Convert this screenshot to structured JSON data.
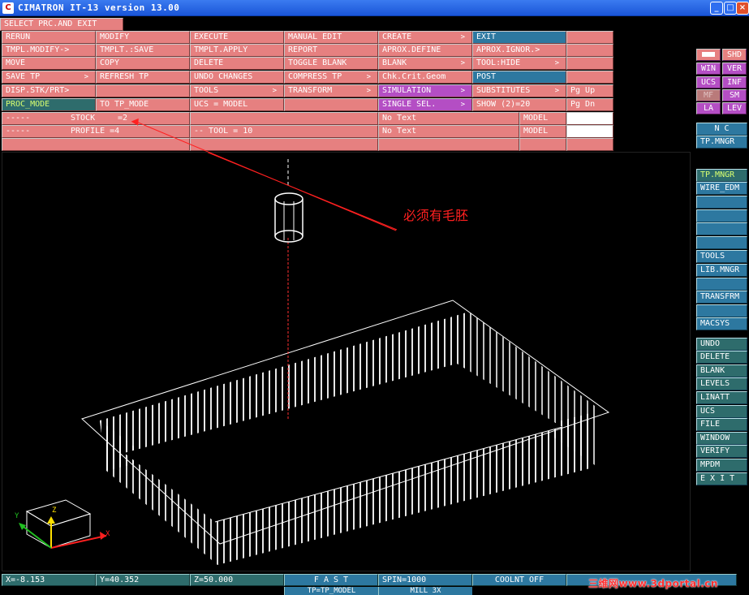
{
  "window": {
    "title": "CIMATRON IT-13 version 13.00",
    "minimize": "_",
    "maximize": "□",
    "close": "×"
  },
  "menu_title": "SELECT PRC.AND EXIT",
  "menu": {
    "rows": [
      [
        "RERUN",
        "MODIFY",
        "EXECUTE",
        "MANUAL EDIT",
        "CREATE",
        "EXIT",
        ""
      ],
      [
        "TMPL.MODIFY->",
        "TMPLT.:SAVE",
        "TMPLT.APPLY",
        "REPORT",
        "APROX.DEFINE",
        "APROX.IGNOR.>",
        ""
      ],
      [
        "MOVE",
        "COPY",
        "DELETE",
        "TOGGLE BLANK",
        "BLANK",
        "TOOL:HIDE",
        ""
      ],
      [
        "SAVE TP",
        "REFRESH TP",
        "UNDO CHANGES",
        "COMPRESS TP",
        "Chk.Crit.Geom",
        "POST",
        ""
      ],
      [
        "DISP.STK/PRT>",
        "",
        "TOOLS",
        "TRANSFORM",
        "SIMULATION",
        "SUBSTITUTES",
        "Pg Up"
      ],
      [
        "PROC_MODE",
        "TO TP_MODE",
        "UCS = MODEL",
        "",
        "SINGLE SEL.",
        "SHOW (2)=20",
        "Pg Dn"
      ]
    ],
    "arrow": ">",
    "info_rows": {
      "r1_left_a": "-----",
      "r1_left_b": "STOCK",
      "r1_left_c": "=2",
      "r1_mid": "No Text",
      "r1_model": "MODEL",
      "r2_left_a": "-----",
      "r2_left_b": "PROFILE =4",
      "r2_tool": "-- TOOL = 10",
      "r2_mid": "No Text",
      "r2_model": "MODEL"
    }
  },
  "right_small": [
    [
      "",
      "SHD"
    ],
    [
      "WIN",
      "VER"
    ],
    [
      "UCS",
      "INF"
    ],
    [
      "MF",
      "SM"
    ],
    [
      "LA",
      "LEV"
    ]
  ],
  "right_panel": {
    "nc": "N C",
    "tp_mngr_top": "TP.MNGR",
    "group1": [
      "TP.MNGR",
      "WIRE_EDM",
      "",
      "",
      "",
      "",
      "TOOLS",
      "LIB.MNGR",
      "",
      "TRANSFRM",
      "",
      "MACSYS"
    ],
    "group2": [
      "UNDO",
      "DELETE",
      "BLANK",
      "LEVELS",
      "LINATT",
      "UCS",
      "FILE",
      "WINDOW",
      "VERIFY",
      "MPDM",
      "E X I T"
    ]
  },
  "annotation": "必须有毛胚",
  "axes": {
    "x": "X",
    "y": "Y",
    "z": "Z"
  },
  "status": {
    "x": "X=-8.153",
    "y": "Y=40.352",
    "z": "Z=50.000",
    "mode": "F A S T",
    "spin": "SPIN=1000",
    "coolant": "COOLNT OFF",
    "tp": "TP=TP_MODEL",
    "mill": "MILL 3X"
  },
  "watermark": "三维网www.3dportal.cn",
  "colors": {
    "menu_pink": "#e68080",
    "blue_btn": "#2d78a0",
    "purple_btn": "#b44ec4",
    "teal_btn": "#2e6c6c",
    "annotation_red": "#ff2020"
  }
}
